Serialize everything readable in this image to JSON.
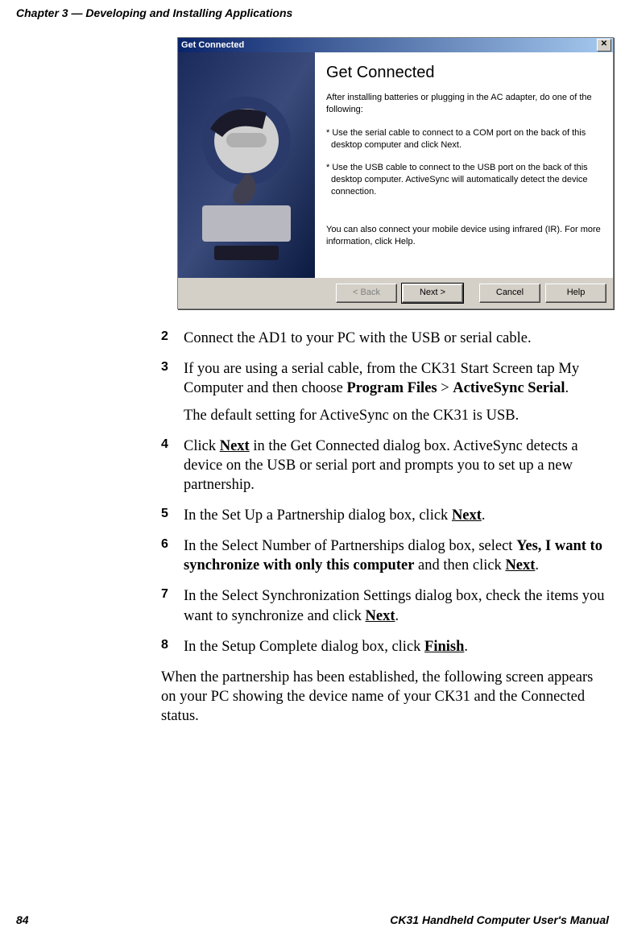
{
  "header": {
    "chapter_line": "Chapter 3 — Developing and Installing Applications"
  },
  "dialog": {
    "title": "Get Connected",
    "heading": "Get Connected",
    "intro": "After installing batteries or plugging in the AC adapter, do one of the following:",
    "bullet1": "* Use the serial cable to connect to a COM port on the back of this desktop computer and click Next.",
    "bullet2": "* Use the USB cable to connect to the USB port on the back of this desktop computer.   ActiveSync will automatically detect the device connection.",
    "footer_text": "You can also connect your mobile device using infrared (IR). For more information, click Help.",
    "close_glyph": "✕",
    "buttons": {
      "back": "< Back",
      "next": "Next >",
      "cancel": "Cancel",
      "help": "Help"
    }
  },
  "steps": {
    "s2": "Connect the AD1 to your PC with the USB or serial cable.",
    "s3a": "If you are using a serial cable, from the CK31 Start Screen tap My Computer and then choose ",
    "s3_pf": "Program Files",
    "s3_gt": " > ",
    "s3_as": "ActiveSync Serial",
    "s3_dot": ".",
    "s3_sub": "The default setting for ActiveSync on the CK31 is USB.",
    "s4a": "Click ",
    "s4_next": "Next",
    "s4b": " in the Get Connected dialog box. ActiveSync detects a device on the USB or serial port and prompts you to set up a new partnership.",
    "s5a": "In the Set Up a Partnership dialog box, click ",
    "s5_next": "Next",
    "s5_dot": ".",
    "s6a": "In the Select Number of Partnerships dialog box, select ",
    "s6_yes": "Yes, I want to synchronize with only this computer",
    "s6b": " and then click ",
    "s6_next": "Next",
    "s6_dot": ".",
    "s7a": "In the Select Synchronization Settings dialog box, check the items you want to synchronize and click ",
    "s7_next": "Next",
    "s7_dot": ".",
    "s8a": "In the Setup Complete dialog box, click ",
    "s8_fin": "Finish",
    "s8_dot": "."
  },
  "after_text": "When the partnership has been established, the following screen appears on your PC showing the device name of your CK31 and the Connected status.",
  "footer": {
    "page": "84",
    "manual": "CK31 Handheld Computer User's Manual"
  }
}
